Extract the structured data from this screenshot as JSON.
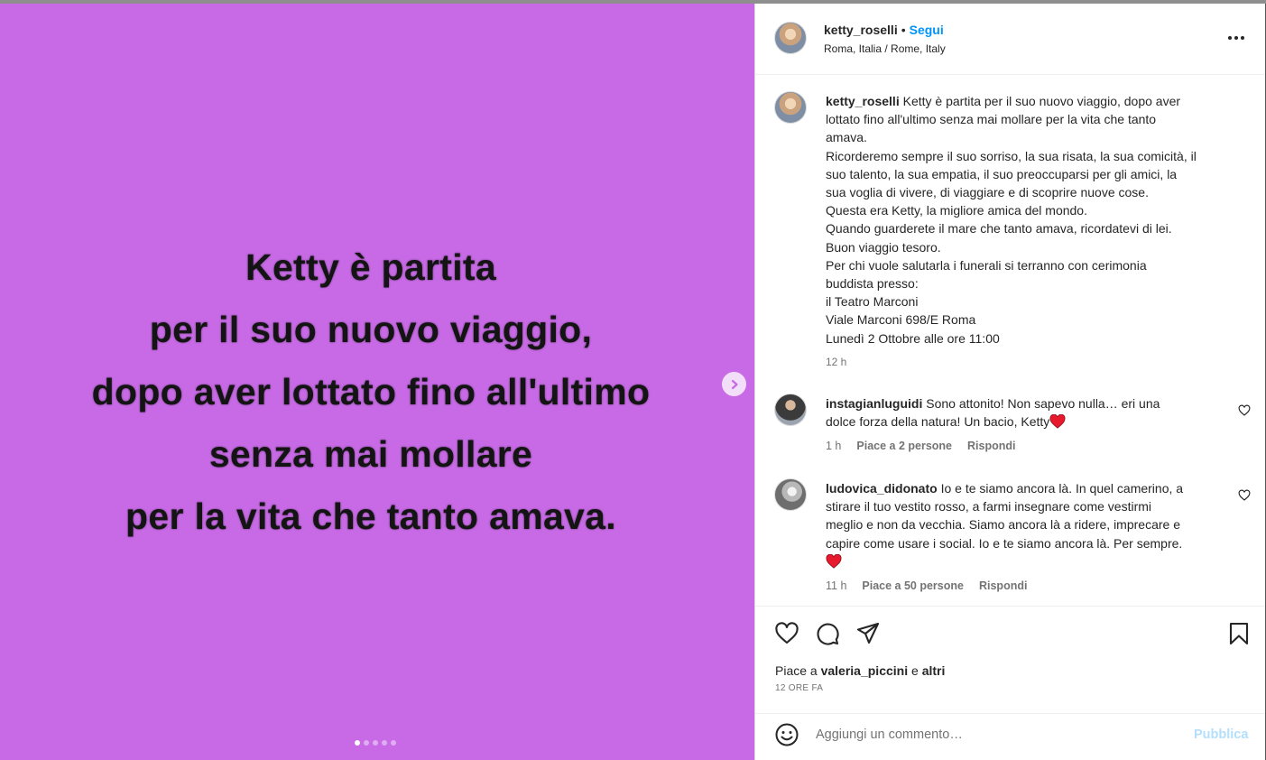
{
  "media": {
    "lines": [
      "Ketty è partita",
      "per il suo nuovo viaggio,",
      "dopo aver lottato fino all'ultimo",
      "senza mai mollare",
      "per la vita che tanto amava."
    ],
    "background": "#c86ae6",
    "carousel_count": 5,
    "carousel_active": 0
  },
  "header": {
    "username": "ketty_roselli",
    "separator": "•",
    "follow": "Segui",
    "location": "Roma, Italia / Rome, Italy"
  },
  "caption": {
    "username": "ketty_roselli",
    "first": "Ketty è partita per il suo nuovo viaggio, dopo aver",
    "lines": [
      "lottato fino all'ultimo senza mai mollare per la vita che tanto",
      "amava.",
      "Ricorderemo sempre il suo sorriso, la sua risata, la sua comicità, il",
      "suo talento, la sua empatia, il suo preoccuparsi per gli amici, la",
      "sua voglia di vivere, di viaggiare e di scoprire nuove cose.",
      "Questa era Ketty, la migliore amica del mondo.",
      "Quando guarderete il mare che tanto amava, ricordatevi di lei.",
      "Buon viaggio tesoro.",
      "Per chi vuole salutarla i funerali si terranno con cerimonia",
      "buddista presso:",
      "il Teatro Marconi",
      "Viale Marconi 698/E Roma",
      "Lunedì 2 Ottobre alle ore 11:00"
    ],
    "time": "12 h"
  },
  "comments": [
    {
      "username": "instagianluguidi",
      "first": "Sono attonito! Non sapevo nulla… eri una",
      "lines": [
        "dolce forza della natura! Un bacio, Ketty"
      ],
      "time": "1 h",
      "likes": "Piace a 2 persone",
      "reply": "Rispondi"
    },
    {
      "username": "ludovica_didonato",
      "first": "Io e te siamo ancora là. In quel camerino, a",
      "lines": [
        "stirare il tuo vestito rosso, a farmi insegnare come vestirmi",
        "meglio e non da vecchia. Siamo ancora là a ridere, imprecare e",
        "capire come usare i social. Io e te siamo ancora là. Per sempre."
      ],
      "time": "11 h",
      "likes": "Piace a 50 persone",
      "reply": "Rispondi"
    }
  ],
  "footer": {
    "likes_prefix": "Piace a",
    "likes_user": "valeria_piccini",
    "likes_and": "e",
    "likes_others": "altri",
    "ago": "12 ORE FA",
    "comment_placeholder": "Aggiungi un commento…",
    "publish": "Pubblica"
  },
  "icons": {
    "like": "heart-icon",
    "comment": "comment-bubble-icon",
    "share": "paper-plane-icon",
    "save": "bookmark-icon",
    "emoji": "smiley-icon",
    "next": "chevron-right-icon",
    "more": "ellipsis-icon"
  },
  "colors": {
    "accent": "#0095f6",
    "publish_disabled": "#b2dffc",
    "heart_red": "#ed4956"
  }
}
